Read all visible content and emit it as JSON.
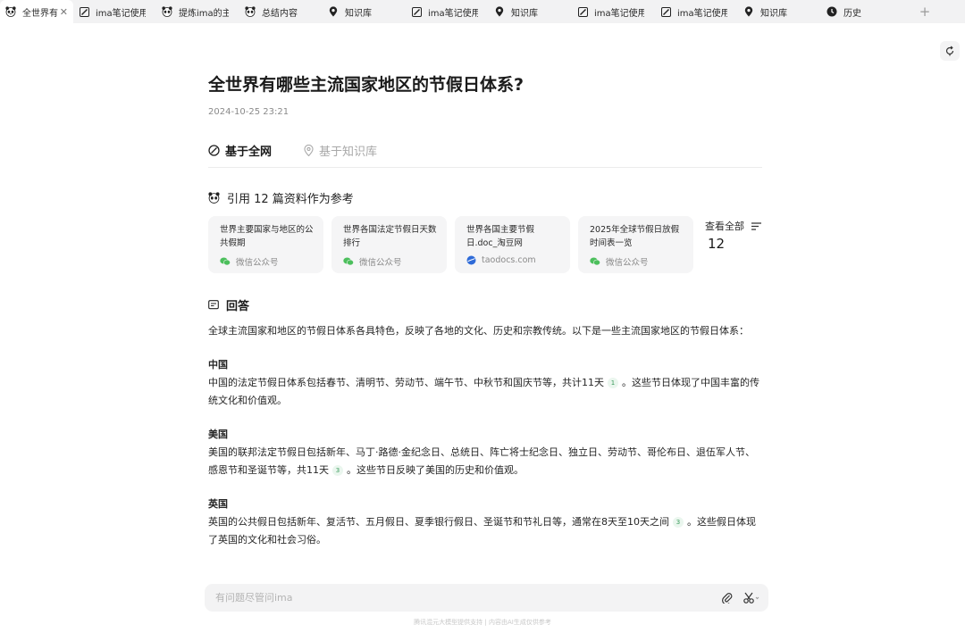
{
  "tabs": [
    {
      "label": "全世界有",
      "icon": "panda-icon",
      "active": true
    },
    {
      "label": "ima笔记使用",
      "icon": "edit-icon"
    },
    {
      "label": "提炼ima的主",
      "icon": "panda-icon"
    },
    {
      "label": "总结内容",
      "icon": "panda-icon"
    },
    {
      "label": "知识库",
      "icon": "location-icon"
    },
    {
      "label": "ima笔记使用",
      "icon": "edit-icon"
    },
    {
      "label": "知识库",
      "icon": "location-icon"
    },
    {
      "label": "ima笔记使用",
      "icon": "edit-icon"
    },
    {
      "label": "ima笔记使用",
      "icon": "edit-icon"
    },
    {
      "label": "知识库",
      "icon": "location-icon"
    },
    {
      "label": "历史",
      "icon": "clock-icon"
    }
  ],
  "question": {
    "title": "全世界有哪些主流国家地区的节假日体系?",
    "date": "2024-10-25 23:21"
  },
  "modes": {
    "web": "基于全网",
    "kb": "基于知识库"
  },
  "references": {
    "heading": "引用 12 篇资料作为参考",
    "view_all": "查看全部",
    "count": "12",
    "cards": [
      {
        "title": "世界主要国家与地区的公共假期",
        "source": "微信公众号",
        "source_icon": "wechat-icon"
      },
      {
        "title": "世界各国法定节假日天数排行",
        "source": "微信公众号",
        "source_icon": "wechat-icon"
      },
      {
        "title": "世界各国主要节假日.doc_淘豆网",
        "source": "taodocs.com",
        "source_icon": "globe-icon"
      },
      {
        "title": "2025年全球节假日放假时间表一览",
        "source": "微信公众号",
        "source_icon": "wechat-icon"
      }
    ]
  },
  "answer": {
    "heading": "回答",
    "intro": "全球主流国家和地区的节假日体系各具特色，反映了各地的文化、历史和宗教传统。以下是一些主流国家地区的节假日体系：",
    "sections": [
      {
        "country": "中国",
        "text_before": "中国的法定节假日体系包括春节、清明节、劳动节、端午节、中秋节和国庆节等，共计11天",
        "cite": "1",
        "text_after": "。这些节日体现了中国丰富的传统文化和价值观。"
      },
      {
        "country": "美国",
        "text_before": "美国的联邦法定节假日包括新年、马丁·路德·金纪念日、总统日、阵亡将士纪念日、独立日、劳动节、哥伦布日、退伍军人节、感恩节和圣诞节等，共11天",
        "cite": "3",
        "text_after": "。这些节日反映了美国的历史和价值观。"
      },
      {
        "country": "英国",
        "text_before": "英国的公共假日包括新年、复活节、五月假日、夏季银行假日、圣诞节和节礼日等，通常在8天至10天之间",
        "cite": "3",
        "text_after": "。这些假日体现了英国的文化和社会习俗。"
      }
    ]
  },
  "ask": {
    "placeholder": "有问题尽管问ima"
  },
  "footer": "腾讯混元大模型提供支持 | 内容由AI生成仅供参考",
  "colors": {
    "accent_green": "#3b9b5c",
    "wechat_green": "#4cbf5c",
    "globe_blue": "#2f6bd8"
  }
}
